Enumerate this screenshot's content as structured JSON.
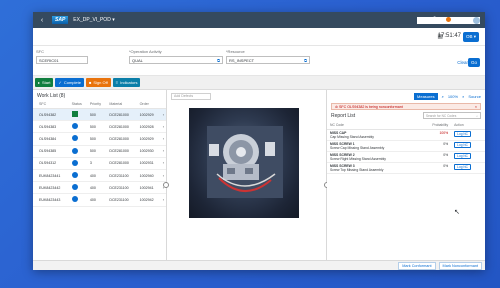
{
  "shell": {
    "logo": "SAP",
    "title": "EX_DP_VI_POD ▾",
    "icons": [
      "search-icon",
      "help-icon",
      "bell-icon",
      "grid-icon",
      "avatar"
    ]
  },
  "subheader": {
    "time": "17:51:47",
    "orbtn": "OB ▾"
  },
  "fields": {
    "sfc": {
      "label": "SFC",
      "value": "SCERIC01"
    },
    "operation": {
      "label": "*Operation Activity",
      "value": "QUAL"
    },
    "resource": {
      "label": "*Resource",
      "value": "RS_INSPECT"
    },
    "clear": "Clear",
    "go": "Go"
  },
  "actions": [
    {
      "label": "Start",
      "cls": "start"
    },
    {
      "label": "Complete",
      "cls": "complete"
    },
    {
      "label": "Sign Off",
      "cls": "signoff"
    },
    {
      "label": "Indicators",
      "cls": "indicators"
    }
  ],
  "work_list": {
    "title": "Work List (8)",
    "columns": [
      "",
      "SFC",
      "Status",
      "Priority",
      "Material",
      "Order",
      ""
    ],
    "rows": [
      {
        "sfc": "OLS94382",
        "status": "square",
        "priority": "500",
        "material": "DCE281000",
        "order": "1002929",
        "selected": true
      },
      {
        "sfc": "OLS94383",
        "status": "dot",
        "priority": "500",
        "material": "DCE281000",
        "order": "1002928",
        "selected": false
      },
      {
        "sfc": "OLS94384",
        "status": "dot",
        "priority": "500",
        "material": "DCE281000",
        "order": "1002929",
        "selected": false
      },
      {
        "sfc": "OLS94385",
        "status": "dot",
        "priority": "500",
        "material": "DCE281000",
        "order": "1002930",
        "selected": false
      },
      {
        "sfc": "OLS94312",
        "status": "dot",
        "priority": "3",
        "material": "DCE281000",
        "order": "1002931",
        "selected": false
      },
      {
        "sfc": "EUK8423441",
        "status": "dot",
        "priority": "400",
        "material": "DCE231100",
        "order": "1002940",
        "selected": false
      },
      {
        "sfc": "EUK8423442",
        "status": "dot",
        "priority": "400",
        "material": "DCE231100",
        "order": "1002941",
        "selected": false
      },
      {
        "sfc": "EUK8423443",
        "status": "dot",
        "priority": "400",
        "material": "DCE231100",
        "order": "1002942",
        "selected": false
      }
    ]
  },
  "image_panel": {
    "placeholder": "Add Defects"
  },
  "right_panel": {
    "toolbar": [
      "Measures",
      "100%",
      "Source"
    ],
    "banner": "SFC OLS94382 is being nonconformant",
    "report_title": "Report List",
    "search_placeholder": "Search for NC Codes",
    "columns": [
      "NC Code",
      "Probability",
      "Action"
    ],
    "rows": [
      {
        "code": "MISS CAP",
        "desc": "Cap Missing Stand Assembly",
        "prob": "100%",
        "red": true,
        "action": "Log NC"
      },
      {
        "code": "MISS SCREW 1",
        "desc": "Screw Cap Missing Stand Assembly",
        "prob": "0%",
        "red": false,
        "action": "Log NC"
      },
      {
        "code": "MISS SCREW 2",
        "desc": "Screw Right Missing Stand Assembly",
        "prob": "0%",
        "red": false,
        "action": "Log NC"
      },
      {
        "code": "MISS SCREW 3",
        "desc": "Screw Top Missing Stand Assembly",
        "prob": "0%",
        "red": false,
        "action": "Log NC"
      }
    ]
  },
  "footer": {
    "mark_conformant": "Mark Conformant",
    "mark_nonconformant": "Mark Nonconformant"
  }
}
